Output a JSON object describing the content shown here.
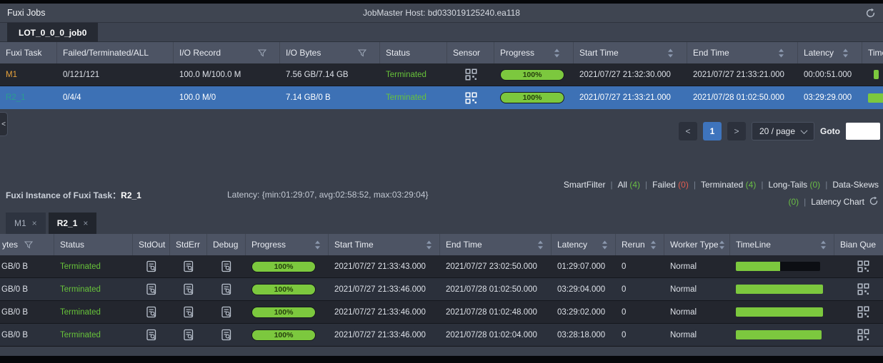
{
  "colors": {
    "selected_row_blue": "#3d71b5",
    "status_green": "#67c23a",
    "progress_green": "#7cc83e",
    "failed_red": "#e05c50",
    "task_link_amber": "#e6a23c",
    "task_link_teal": "#2a9d8f",
    "header_bg": "#4d5464",
    "page_bg": "#3a404c"
  },
  "header": {
    "title": "Fuxi Jobs",
    "host": "JobMaster Host: bd033019125240.ea118"
  },
  "icons": {
    "prev": "<",
    "next": ">",
    "close": "×",
    "collapse": "<"
  },
  "top_panel": {
    "tab_label": "LOT_0_0_0_job0",
    "columns": {
      "task": "Fuxi Task",
      "fta": "Failed/Terminated/ALL",
      "io_record": "I/O Record",
      "io_bytes": "I/O Bytes",
      "status": "Status",
      "sensor": "Sensor",
      "progress": "Progress",
      "start": "Start Time",
      "end": "End Time",
      "latency": "Latency",
      "timeline": "TimeLine"
    },
    "rows": [
      {
        "task": "M1",
        "fta": "0/121/121",
        "io_record": "100.0 M/100.0 M",
        "io_bytes": "7.56 GB/7.14 GB",
        "status": "Terminated",
        "progress": "100%",
        "start": "2021/07/27 21:32:30.000",
        "end": "2021/07/27 21:33:21.000",
        "latency": "00:00:51.000",
        "tl_style": "margin-left:8px;width:7px"
      },
      {
        "task": "R2_1",
        "fta": "0/4/4",
        "io_record": "100.0 M/0",
        "io_bytes": "7.14 GB/0 B",
        "status": "Terminated",
        "progress": "100%",
        "start": "2021/07/27 21:33:21.000",
        "end": "2021/07/28 01:02:50.000",
        "latency": "03:29:29.000",
        "tl_style": "width:44px"
      }
    ],
    "pagination": {
      "page": "1",
      "size": "20 / page",
      "goto_label": "Goto"
    }
  },
  "instance_panel": {
    "title_prefix": "Fuxi Instance of Fuxi Task：",
    "title_task": "R2_1",
    "latency_summary": "Latency: {min:01:29:07, avg:02:58:52, max:03:29:04}",
    "filters": {
      "label": "SmartFilter",
      "items": [
        {
          "name": "All",
          "count": "(4)"
        },
        {
          "name": "Failed",
          "count": "(0)"
        },
        {
          "name": "Terminated",
          "count": "(4)"
        },
        {
          "name": "Long-Tails",
          "count": "(0)"
        },
        {
          "name": "Data-Skews",
          "count": "(0)"
        }
      ],
      "latency_chart": "Latency Chart"
    },
    "tabs": [
      {
        "label": "M1"
      },
      {
        "label": "R2_1"
      }
    ],
    "columns": {
      "bytes": "ytes",
      "status": "Status",
      "stdout": "StdOut",
      "stderr": "StdErr",
      "debug": "Debug",
      "progress": "Progress",
      "start": "Start Time",
      "end": "End Time",
      "latency": "Latency",
      "rerun": "Rerun",
      "worker": "Worker Type",
      "timeline": "TimeLine",
      "bianque": "Bian Que"
    },
    "rows": [
      {
        "bytes": "GB/0 B",
        "status": "Terminated",
        "progress": "100%",
        "start": "2021/07/27 21:33:43.000",
        "end": "2021/07/27 23:02:50.000",
        "latency": "01:29:07.000",
        "rerun": "0",
        "worker": "Normal",
        "tl_green": "width:62px",
        "tl_dark": "width:56px"
      },
      {
        "bytes": "GB/0 B",
        "status": "Terminated",
        "progress": "100%",
        "start": "2021/07/27 21:33:46.000",
        "end": "2021/07/28 01:02:50.000",
        "latency": "03:29:04.000",
        "rerun": "0",
        "worker": "Normal",
        "tl_green": "width:122px",
        "tl_dark": "width:0px"
      },
      {
        "bytes": "GB/0 B",
        "status": "Terminated",
        "progress": "100%",
        "start": "2021/07/27 21:33:46.000",
        "end": "2021/07/28 01:02:48.000",
        "latency": "03:29:02.000",
        "rerun": "0",
        "worker": "Normal",
        "tl_green": "width:122px",
        "tl_dark": "width:0px"
      },
      {
        "bytes": "GB/0 B",
        "status": "Terminated",
        "progress": "100%",
        "start": "2021/07/27 21:33:46.000",
        "end": "2021/07/28 01:02:04.000",
        "latency": "03:28:18.000",
        "rerun": "0",
        "worker": "Normal",
        "tl_green": "width:120px",
        "tl_dark": "width:0px"
      }
    ]
  }
}
